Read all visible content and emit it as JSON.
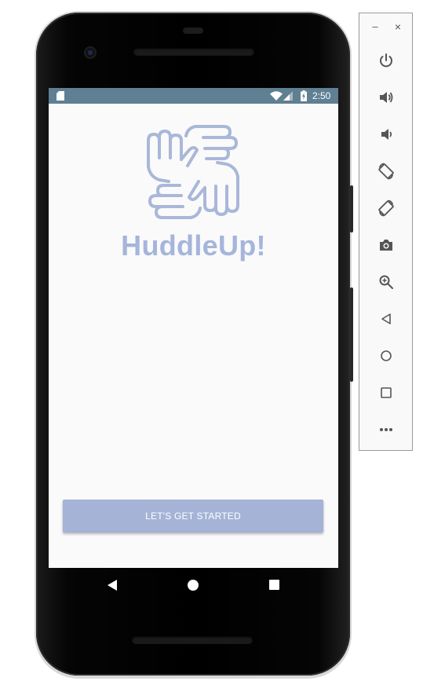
{
  "status_bar": {
    "time": "2:50",
    "icons": [
      "sd-card-icon",
      "wifi-icon",
      "cell-signal-icon",
      "battery-charging-icon"
    ]
  },
  "app": {
    "name": "HuddleUp!",
    "logo_icon": "hands-huddle-icon",
    "start_button_label": "LET'S GET STARTED"
  },
  "nav_bar": {
    "icons": [
      "back-icon",
      "home-icon",
      "recents-icon"
    ]
  },
  "emulator_toolbar": {
    "window_controls": {
      "minimize": "–",
      "close": "×"
    },
    "buttons": [
      "power-icon",
      "volume-up-icon",
      "volume-down-icon",
      "rotate-left-icon",
      "rotate-right-icon",
      "camera-icon",
      "zoom-icon",
      "back-triangle-icon",
      "home-circle-icon",
      "overview-square-icon",
      "more-icon"
    ]
  },
  "colors": {
    "status_bar": "#5f7f92",
    "accent": "#a4b3d6",
    "screen_background": "#fafafa",
    "phone_body": "#000000",
    "toolbar_icon": "#555555"
  }
}
